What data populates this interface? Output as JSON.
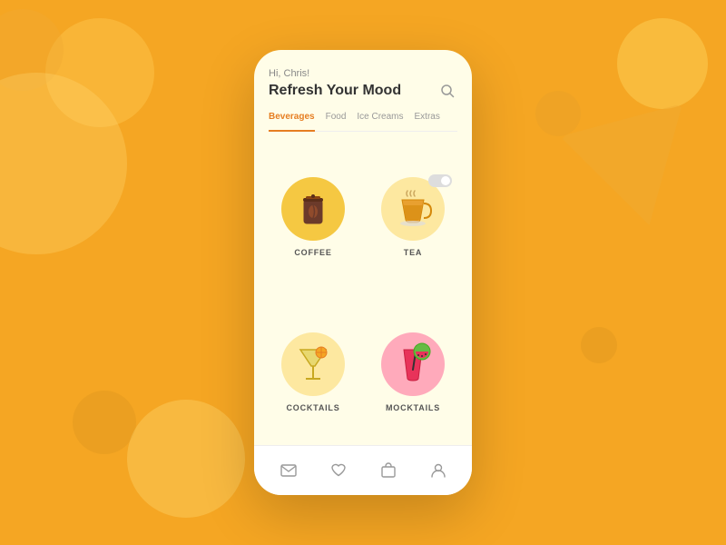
{
  "background": {
    "color": "#F5A623"
  },
  "app": {
    "greeting": "Hi, Chris!",
    "title": "Refresh Your Mood",
    "tabs": [
      {
        "label": "Beverages",
        "active": true
      },
      {
        "label": "Food",
        "active": false
      },
      {
        "label": "Ice Creams",
        "active": false
      },
      {
        "label": "Extras",
        "active": false
      }
    ],
    "categories": [
      {
        "id": "coffee",
        "label": "COFFEE",
        "icon": "coffee-icon",
        "bgClass": "coffee-bg"
      },
      {
        "id": "tea",
        "label": "TEA",
        "icon": "tea-icon",
        "bgClass": "tea-bg"
      },
      {
        "id": "cocktails",
        "label": "COCKTAILS",
        "icon": "cocktail-icon",
        "bgClass": "cocktail-bg"
      },
      {
        "id": "mocktails",
        "label": "MOCKTAILS",
        "icon": "mocktail-icon",
        "bgClass": "mocktail-bg"
      }
    ],
    "nav": [
      {
        "id": "mail",
        "icon": "mail-icon"
      },
      {
        "id": "heart",
        "icon": "heart-icon"
      },
      {
        "id": "bag",
        "icon": "bag-icon"
      },
      {
        "id": "user",
        "icon": "user-icon"
      }
    ]
  }
}
